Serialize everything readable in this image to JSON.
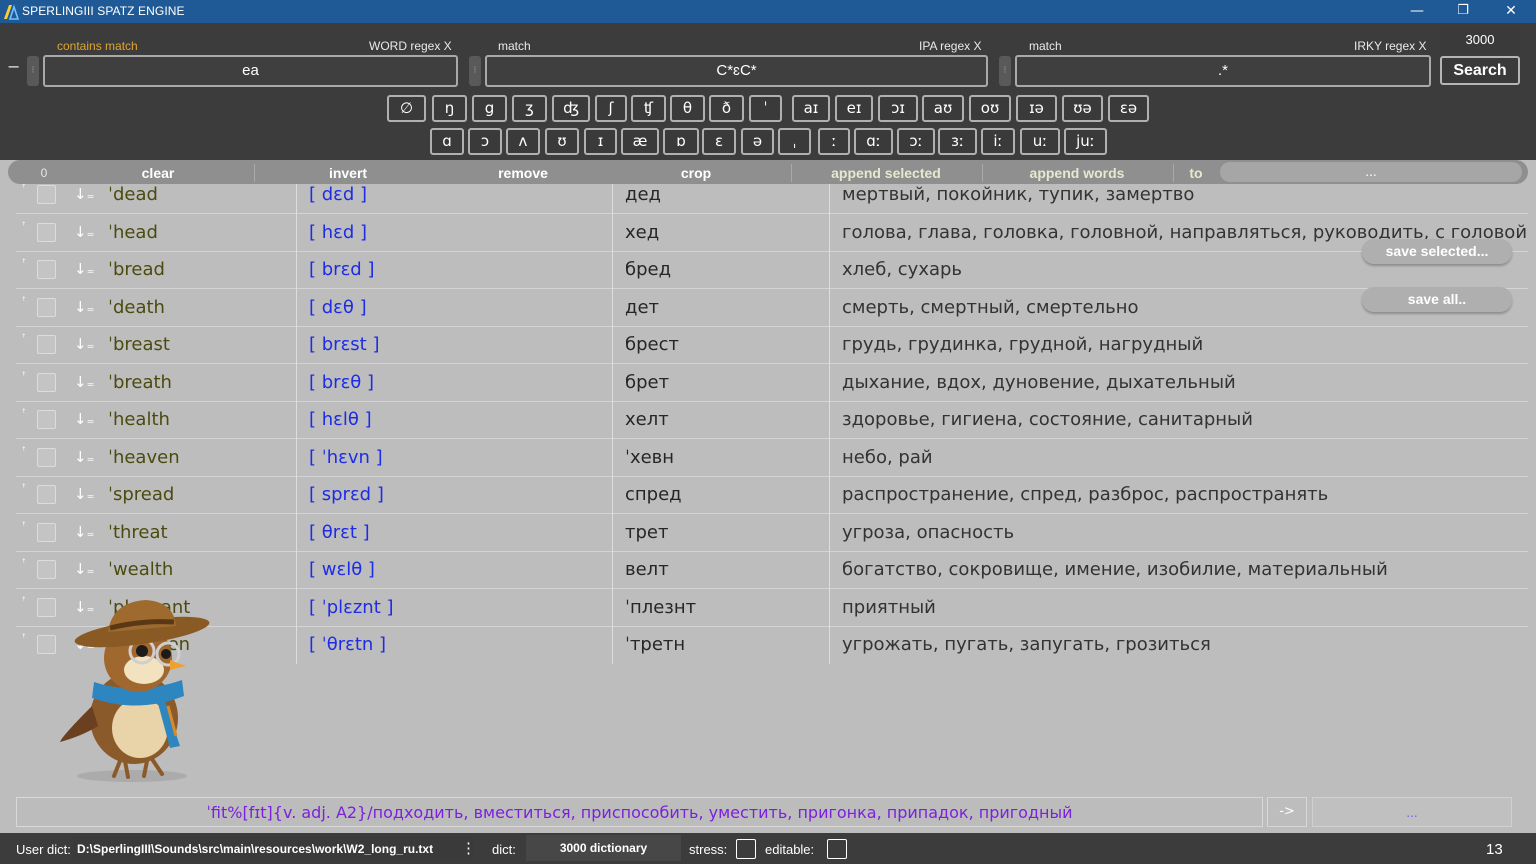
{
  "window": {
    "title": "SPERLINGIII  SPATZ ENGINE",
    "minimize": "—",
    "restore": "❐",
    "close": "✕"
  },
  "search": {
    "word": {
      "left_label": "contains match",
      "right_label": "WORD regex X",
      "value": "ea"
    },
    "ipa": {
      "left_label": "match",
      "right_label": "IPA regex X",
      "value": "C*ɛC*"
    },
    "irky": {
      "left_label": "match",
      "right_label": "IRKY regex X",
      "value": ".*"
    },
    "count": "3000",
    "search_label": "Search",
    "minus": "−",
    "handle": "⁝"
  },
  "symbols_row1": [
    "∅",
    "ŋ",
    "g",
    "ʒ",
    "ʤ",
    "ʃ",
    "ʧ",
    "θ",
    "ð",
    "ˈ",
    "aɪ",
    "eɪ",
    "ɔɪ",
    "aʊ",
    "oʊ",
    "ɪə",
    "ʊə",
    "ɛə"
  ],
  "symbols_row2": [
    "ɑ",
    "ɔ",
    "ʌ",
    "ʊ",
    "ɪ",
    "æ",
    "ɒ",
    "ɛ",
    "ə",
    "ˌ",
    "ː",
    "ɑː",
    "ɔː",
    "ɜː",
    "iː",
    "uː",
    "juː"
  ],
  "toolbar": {
    "count": "0",
    "clear": "clear",
    "invert": "invert",
    "remove": "remove",
    "crop": "crop",
    "append_selected": "append selected",
    "append_words": "append words",
    "to": "to",
    "to_value": "..."
  },
  "row_marks": {
    "mark": "ꜛ",
    "arrow": "↓₌"
  },
  "rows": [
    {
      "word": "ˈdead",
      "ipa": "[ dɛd ]",
      "rus": "дед",
      "tr": "мертвый, покойник, тупик, замертво"
    },
    {
      "word": "ˈhead",
      "ipa": "[ hɛd ]",
      "rus": "хед",
      "tr": "голова, глава, головка, головной, направляться, руководить, с головой"
    },
    {
      "word": "ˈbread",
      "ipa": "[ brɛd ]",
      "rus": "бред",
      "tr": "хлеб, сухарь"
    },
    {
      "word": "ˈdeath",
      "ipa": "[ dɛθ ]",
      "rus": "дет",
      "tr": "смерть, смертный, смертельно"
    },
    {
      "word": "ˈbreast",
      "ipa": "[ brɛst ]",
      "rus": "брест",
      "tr": "грудь, грудинка, грудной, нагрудный"
    },
    {
      "word": "ˈbreath",
      "ipa": "[ brɛθ ]",
      "rus": "брет",
      "tr": "дыхание, вдох, дуновение, дыхательный"
    },
    {
      "word": "ˈhealth",
      "ipa": "[ hɛlθ ]",
      "rus": "хелт",
      "tr": "здоровье, гигиена, состояние, санитарный"
    },
    {
      "word": "ˈheaven",
      "ipa": "[ ˈhɛvn ]",
      "rus": "ˈхевн",
      "tr": "небо, рай"
    },
    {
      "word": "ˈspread",
      "ipa": "[ sprɛd ]",
      "rus": "спред",
      "tr": "распространение, спред, разброс, распространять"
    },
    {
      "word": "ˈthreat",
      "ipa": "[ θrɛt ]",
      "rus": "трет",
      "tr": "угроза, опасность"
    },
    {
      "word": "ˈwealth",
      "ipa": "[ wɛlθ ]",
      "rus": "велт",
      "tr": "богатство, сокровище, имение, изобилие, материальный"
    },
    {
      "word": "ˈpleasant",
      "ipa": "[ ˈplɛznt ]",
      "rus": "ˈплезнт",
      "tr": "приятный"
    },
    {
      "word": "ˈthreaten",
      "ipa": "[ ˈθrɛtn ]",
      "rus": "ˈтретн",
      "tr": "угрожать, пугать, запугать, грозиться"
    }
  ],
  "side": {
    "save_selected": "save selected...",
    "save_all": "save all.."
  },
  "bottom": {
    "entry": "ˈfit%[fɪt]{v. adj. A2}/подходить, вместиться, приспособить, уместить, пригонка, припадок, пригодный",
    "arrow": "->",
    "dots": "..."
  },
  "status": {
    "user_dict_label": "User dict:",
    "user_dict_path": "D:\\SperlingIII\\Sounds\\src\\main\\resources\\work\\W2_long_ru.txt",
    "menu": "⋮",
    "dict_label": "dict:",
    "dict_value": "3000 dictionary",
    "stress_label": "stress:",
    "editable_label": "editable:",
    "count": "13"
  },
  "colors": {
    "titlebar": "#1f5a96",
    "panel": "#3c3c3c",
    "table_bg": "#bdbdbd",
    "word": "#4b4b10",
    "ipa": "#1d2ce6",
    "accent_orange": "#e1a52f",
    "entry_purple": "#7c1fe0"
  }
}
